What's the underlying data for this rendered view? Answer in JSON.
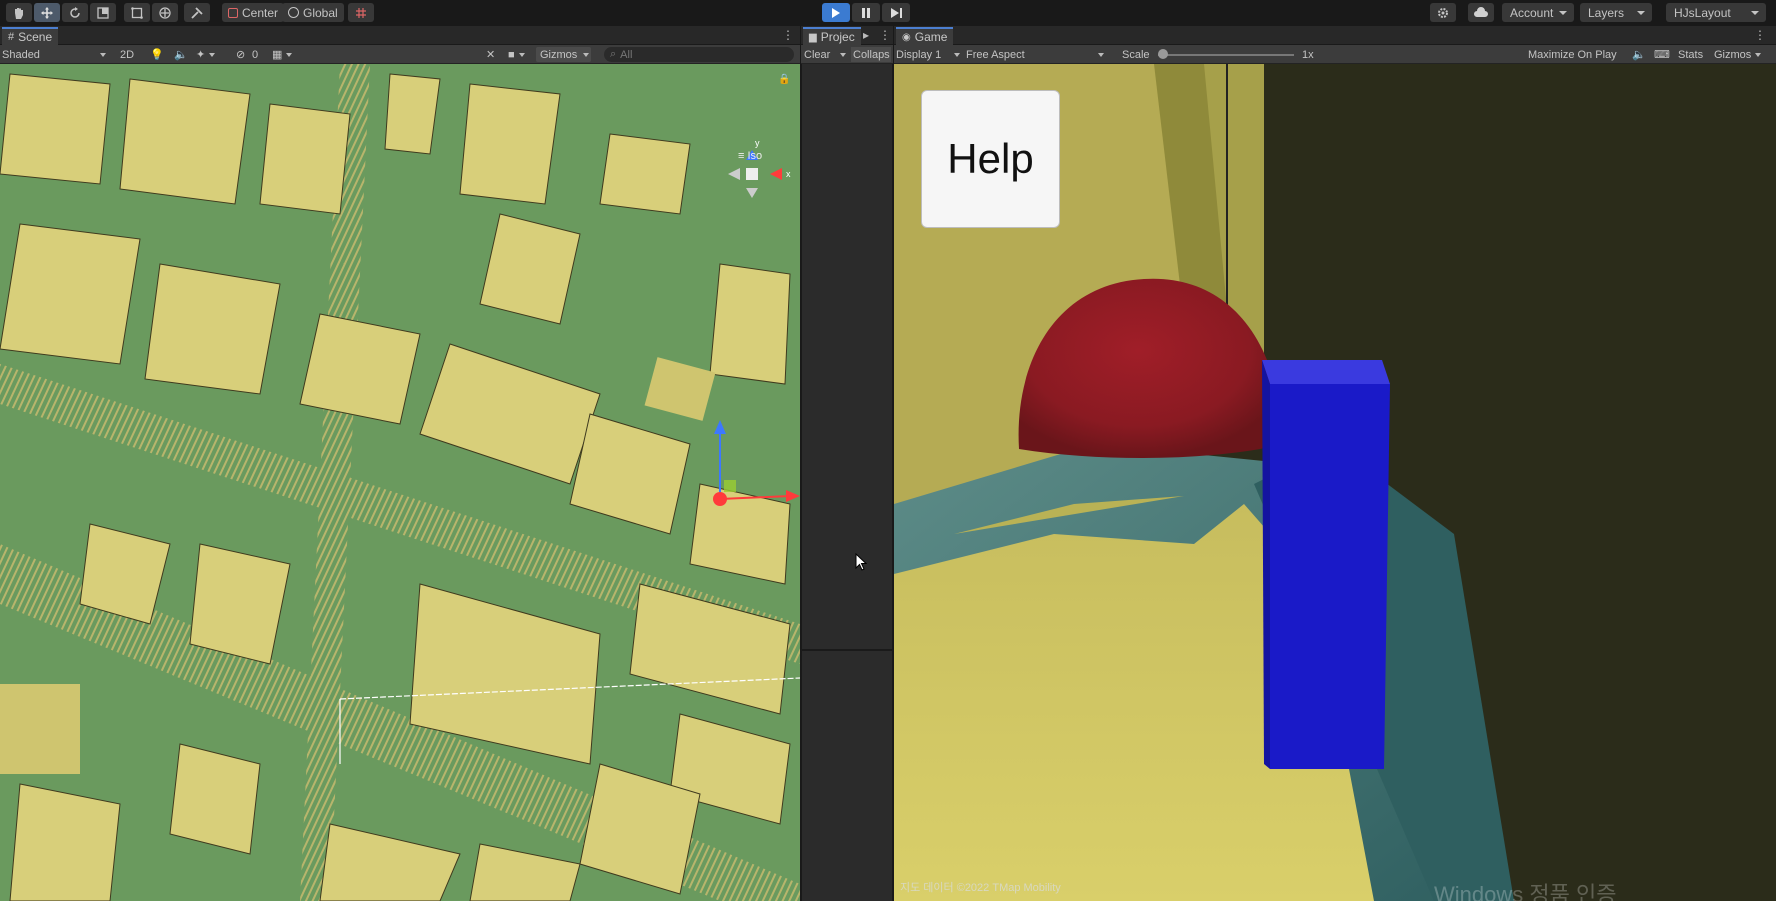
{
  "toolbar": {
    "tools": [
      "hand-tool",
      "move-tool",
      "rotate-tool",
      "scale-tool",
      "rect-tool",
      "transform-tool",
      "custom-tool"
    ],
    "pivot_label": "Center",
    "space_label": "Global",
    "account_label": "Account",
    "layers_label": "Layers",
    "layout_label": "HJsLayout"
  },
  "scene": {
    "tab": "Scene",
    "shading": "Shaded",
    "mode_2d": "2D",
    "hidden_count": "0",
    "gizmos": "Gizmos",
    "search_placeholder": "All",
    "projection_label": "Iso",
    "axis_y": "y",
    "axis_x": "x"
  },
  "project": {
    "tab": "Projec",
    "clear_label": "Clear",
    "collapse_label": "Collaps"
  },
  "game": {
    "tab": "Game",
    "display": "Display 1",
    "aspect": "Free Aspect",
    "scale_label": "Scale",
    "scale_value": "1x",
    "maximize_label": "Maximize On Play",
    "stats_label": "Stats",
    "gizmos": "Gizmos",
    "help_button": "Help",
    "copyright": "지도 데이터 ©2022 TMap Mobility",
    "watermark": "Windows 정품 인증"
  },
  "colors": {
    "play_accent": "#3b7bd1",
    "ground_green": "#6a9a5e",
    "building_yellow": "#d8cf7a",
    "sphere_red": "#8e1c22",
    "cube_blue": "#1a1ac8"
  }
}
